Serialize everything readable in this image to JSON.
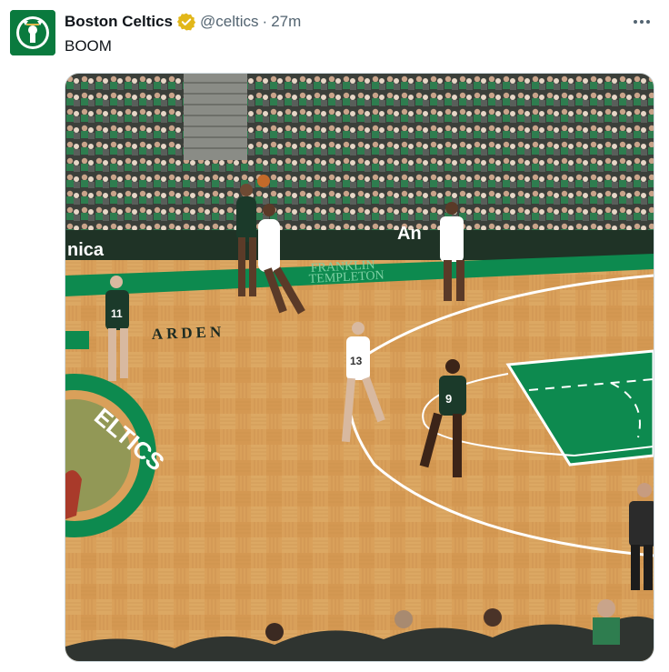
{
  "tweet": {
    "display_name": "Boston Celtics",
    "handle": "@celtics",
    "separator": "·",
    "timestamp": "27m",
    "text": "BOOM",
    "verified_icon": "verified-badge-gold",
    "avatar_icon": "celtics-logo",
    "more_icon": "more-horizontal-icon"
  },
  "media": {
    "type": "video-still",
    "court_text": {
      "sponsor_left": "nica",
      "sponsor_center": "An",
      "arena_top": "FRANKLIN",
      "arena_bottom": "TEMPLETON",
      "garden": "ARDEN",
      "logo": "ELTICS"
    },
    "jerseys": [
      "11",
      "13",
      "9"
    ],
    "colors": {
      "floor": "#d9a05a",
      "green": "#0d8a4f",
      "dark_green": "#1b3a2a",
      "crowd": "#3b3f3a"
    }
  }
}
